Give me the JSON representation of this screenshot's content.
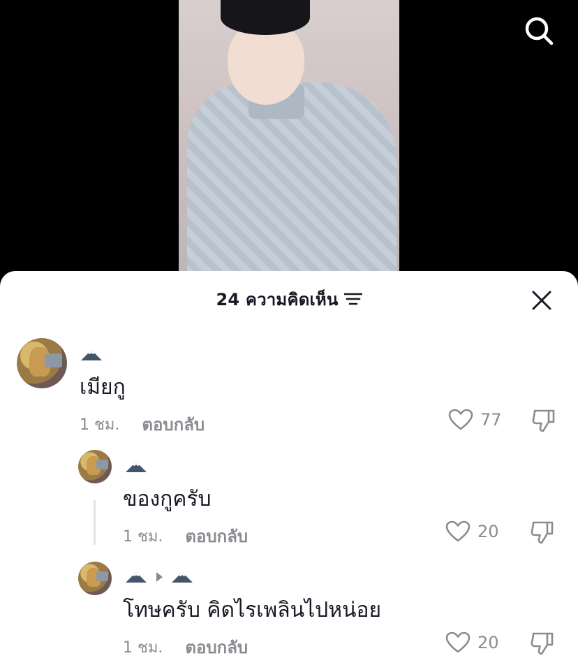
{
  "sheet": {
    "title": "24 ความคิดเห็น"
  },
  "icons": {
    "search": "search-icon",
    "filter": "filter-icon",
    "close": "close-icon",
    "heart": "heart-icon",
    "dislike": "thumbs-down-icon",
    "mountain": "mountain-icon",
    "reply_arrow": "caret-right-icon"
  },
  "colors": {
    "text_primary": "#161823",
    "text_secondary": "#8a8b91",
    "sheet_bg": "#ffffff",
    "backdrop": "#000000"
  },
  "comments": [
    {
      "text": "เมียกู",
      "time": "1 ชม.",
      "reply_label": "ตอบกลับ",
      "likes": "77"
    },
    {
      "text": "ของกูครับ",
      "time": "1 ชม.",
      "reply_label": "ตอบกลับ",
      "likes": "20"
    },
    {
      "text": "โทษครับ คิดไรเพลินไปหน่อย",
      "time": "1 ชม.",
      "reply_label": "ตอบกลับ",
      "likes": "20"
    }
  ]
}
